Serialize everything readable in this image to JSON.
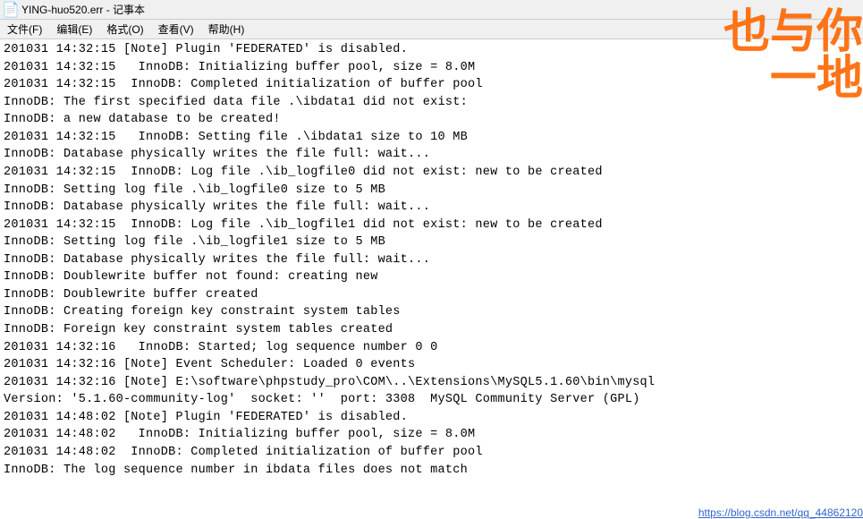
{
  "titlebar": {
    "title": "YING-huo520.err - 记事本",
    "icon": "📄"
  },
  "menubar": {
    "items": [
      {
        "label": "文件(F)"
      },
      {
        "label": "编辑(E)"
      },
      {
        "label": "格式(O)"
      },
      {
        "label": "查看(V)"
      },
      {
        "label": "帮助(H)"
      }
    ]
  },
  "watermark": {
    "line1": "也与你",
    "line2": "一地"
  },
  "log_lines": [
    "201031 14:32:15 [Note] Plugin 'FEDERATED' is disabled.",
    "201031 14:32:15   InnoDB: Initializing buffer pool, size = 8.0M",
    "201031 14:32:15  InnoDB: Completed initialization of buffer pool",
    "InnoDB: The first specified data file .\\ibdata1 did not exist:",
    "InnoDB: a new database to be created!",
    "201031 14:32:15   InnoDB: Setting file .\\ibdata1 size to 10 MB",
    "InnoDB: Database physically writes the file full: wait...",
    "201031 14:32:15  InnoDB: Log file .\\ib_logfile0 did not exist: new to be created",
    "InnoDB: Setting log file .\\ib_logfile0 size to 5 MB",
    "InnoDB: Database physically writes the file full: wait...",
    "201031 14:32:15  InnoDB: Log file .\\ib_logfile1 did not exist: new to be created",
    "InnoDB: Setting log file .\\ib_logfile1 size to 5 MB",
    "InnoDB: Database physically writes the file full: wait...",
    "InnoDB: Doublewrite buffer not found: creating new",
    "InnoDB: Doublewrite buffer created",
    "InnoDB: Creating foreign key constraint system tables",
    "InnoDB: Foreign key constraint system tables created",
    "201031 14:32:16   InnoDB: Started; log sequence number 0 0",
    "201031 14:32:16 [Note] Event Scheduler: Loaded 0 events",
    "201031 14:32:16 [Note] E:\\software\\phpstudy_pro\\COM\\..\\Extensions\\MySQL5.1.60\\bin\\mysql",
    "Version: '5.1.60-community-log'  socket: ''  port: 3308  MySQL Community Server (GPL)",
    "201031 14:48:02 [Note] Plugin 'FEDERATED' is disabled.",
    "201031 14:48:02   InnoDB: Initializing buffer pool, size = 8.0M",
    "201031 14:48:02  InnoDB: Completed initialization of buffer pool",
    "InnoDB: The log sequence number in ibdata files does not match"
  ],
  "bottom_link": "https://blog.csdn.net/qq_44862120"
}
